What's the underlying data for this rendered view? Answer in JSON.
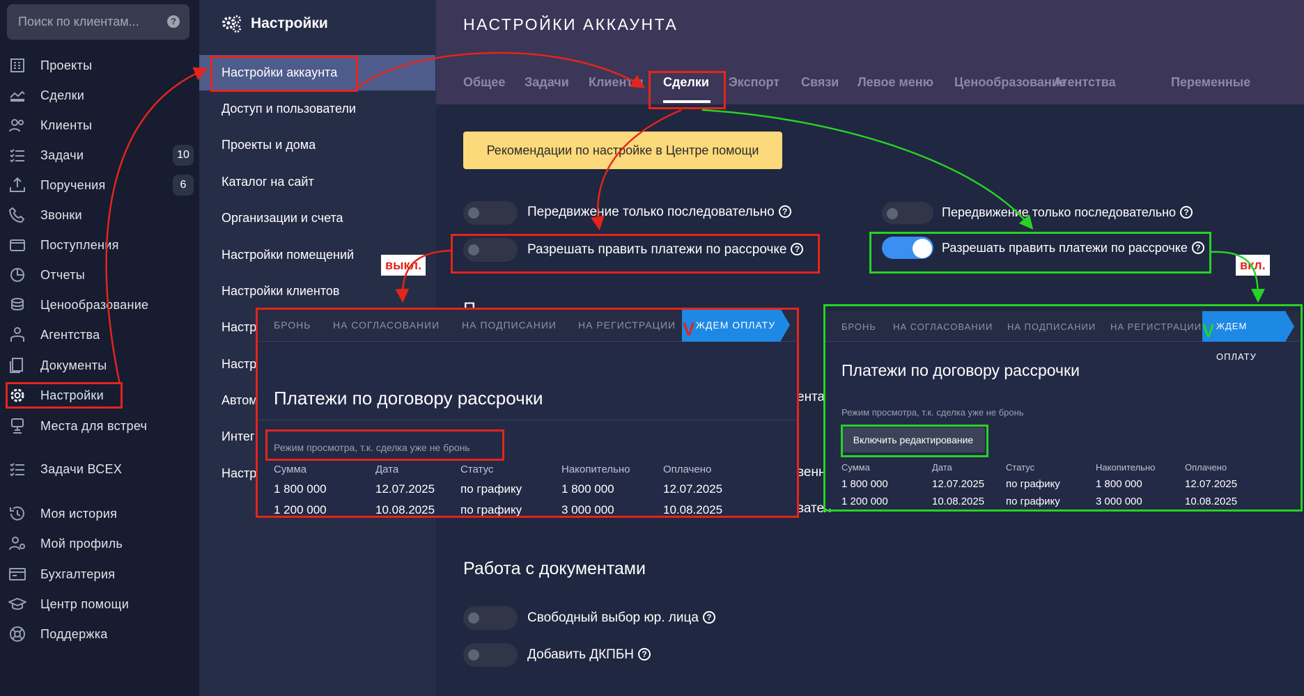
{
  "search": {
    "placeholder": "Поиск по клиентам..."
  },
  "sidebar": {
    "items": [
      {
        "label": "Проекты",
        "icon": "building-icon"
      },
      {
        "label": "Сделки",
        "icon": "deal-icon"
      },
      {
        "label": "Клиенты",
        "icon": "users-icon"
      },
      {
        "label": "Задачи",
        "icon": "tasks-icon",
        "badge": "10"
      },
      {
        "label": "Поручения",
        "icon": "assignment-icon",
        "badge": "6"
      },
      {
        "label": "Звонки",
        "icon": "phone-icon"
      },
      {
        "label": "Поступления",
        "icon": "wallet-icon"
      },
      {
        "label": "Отчеты",
        "icon": "chart-icon"
      },
      {
        "label": "Ценообразование",
        "icon": "coins-icon"
      },
      {
        "label": "Агентства",
        "icon": "agent-icon"
      },
      {
        "label": "Документы",
        "icon": "documents-icon"
      },
      {
        "label": "Настройки",
        "icon": "gear-icon"
      },
      {
        "label": "Места для встреч",
        "icon": "meeting-icon"
      },
      {
        "label": "Задачи ВСЕХ",
        "icon": "tasks-all-icon"
      },
      {
        "label": "Моя история",
        "icon": "history-icon"
      },
      {
        "label": "Мой профиль",
        "icon": "profile-icon"
      },
      {
        "label": "Бухгалтерия",
        "icon": "accounting-icon"
      },
      {
        "label": "Центр помощи",
        "icon": "graduation-icon"
      },
      {
        "label": "Поддержка",
        "icon": "lifebuoy-icon"
      }
    ]
  },
  "settings_menu": {
    "title": "Настройки",
    "items": [
      "Настройки аккаунта",
      "Доступ и пользователи",
      "Проекты и дома",
      "Каталог на сайт",
      "Организации и счета",
      "Настройки помещений",
      "Настройки клиентов",
      "Настр",
      "Настр",
      "Автом",
      "Интег",
      "Настр"
    ]
  },
  "page": {
    "title": "НАСТРОЙКИ АККАУНТА",
    "tabs": [
      "Общее",
      "Задачи",
      "Клиенты",
      "Сделки",
      "Экспорт",
      "Связи",
      "Левое меню",
      "Ценообразование",
      "Агентства",
      "Переменные"
    ],
    "active_tab": "Сделки",
    "help_button": "Рекомендации по настройке в Центре помощи",
    "toggles_left": [
      {
        "label": "Передвижение только последовательно",
        "on": false
      },
      {
        "label": "Разрешать править платежи по рассрочке",
        "on": false
      }
    ],
    "toggles_right": [
      {
        "label": "Передвижение только последовательно",
        "on": false
      },
      {
        "label": "Разрешать править платежи по рассрочке",
        "on": true
      }
    ],
    "partial_texts": [
      "П",
      "ента",
      "венн",
      "вател"
    ],
    "docs_section": {
      "title": "Работа с документами",
      "toggles": [
        {
          "label": "Свободный выбор юр. лица",
          "on": false
        },
        {
          "label": "Добавить ДКПБН",
          "on": false
        }
      ]
    }
  },
  "annotations": {
    "off_label": "выкл.",
    "on_label": "вкл.",
    "check_mark": "V",
    "red": "#e3251b",
    "green": "#27d324"
  },
  "panel_off": {
    "stages": [
      "БРОНЬ",
      "НА СОГЛАСОВАНИИ",
      "НА ПОДПИСАНИИ",
      "НА РЕГИСТРАЦИИ",
      "ЖДЕМ ОПЛАТУ"
    ],
    "title": "Платежи по договору рассрочки",
    "note": "Режим просмотра, т.к. сделка уже не бронь",
    "columns": [
      "Сумма",
      "Дата",
      "Статус",
      "Накопительно",
      "Оплачено"
    ],
    "rows": [
      [
        "1 800 000",
        "12.07.2025",
        "по графику",
        "1 800 000",
        "12.07.2025"
      ],
      [
        "1 200 000",
        "10.08.2025",
        "по графику",
        "3 000 000",
        "10.08.2025"
      ]
    ]
  },
  "panel_on": {
    "stages": [
      "БРОНЬ",
      "НА СОГЛАСОВАНИИ",
      "НА ПОДПИСАНИИ",
      "НА РЕГИСТРАЦИИ",
      "ЖДЕМ ОПЛАТУ"
    ],
    "title": "Платежи по договору рассрочки",
    "note": "Режим просмотра, т.к. сделка уже не бронь",
    "edit_button": "Включить редактирование",
    "columns": [
      "Сумма",
      "Дата",
      "Статус",
      "Накопительно",
      "Оплачено"
    ],
    "rows": [
      [
        "1 800 000",
        "12.07.2025",
        "по графику",
        "1 800 000",
        "12.07.2025"
      ],
      [
        "1 200 000",
        "10.08.2025",
        "по графику",
        "3 000 000",
        "10.08.2025"
      ]
    ]
  }
}
